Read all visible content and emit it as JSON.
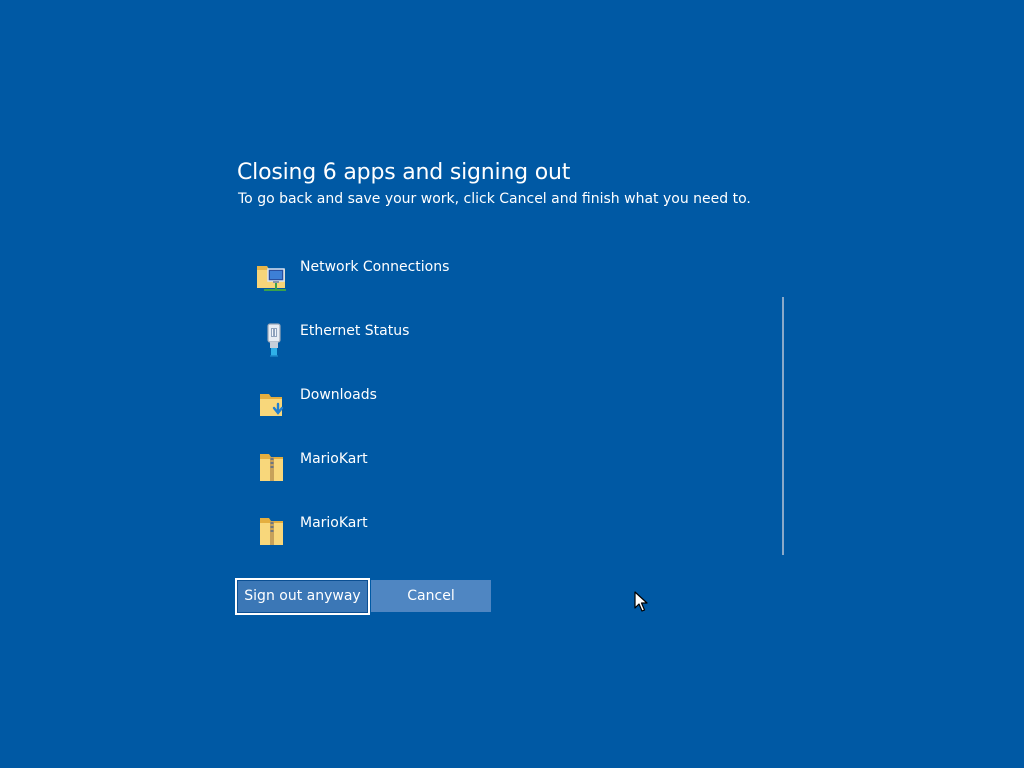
{
  "dialog": {
    "title": "Closing 6 apps and signing out",
    "subtitle": "To go back and save your work, click Cancel and finish what you need to."
  },
  "apps": [
    {
      "label": "Network Connections",
      "icon": "network-connections-icon"
    },
    {
      "label": "Ethernet Status",
      "icon": "ethernet-status-icon"
    },
    {
      "label": "Downloads",
      "icon": "downloads-folder-icon"
    },
    {
      "label": "MarioKart",
      "icon": "zip-folder-icon"
    },
    {
      "label": "MarioKart",
      "icon": "zip-folder-icon"
    }
  ],
  "buttons": {
    "sign_out_label": "Sign out anyway",
    "cancel_label": "Cancel"
  },
  "colors": {
    "background": "#0059a4",
    "primary_button": "#3b77b6",
    "secondary_button": "#4f86c2",
    "text": "#ffffff"
  }
}
